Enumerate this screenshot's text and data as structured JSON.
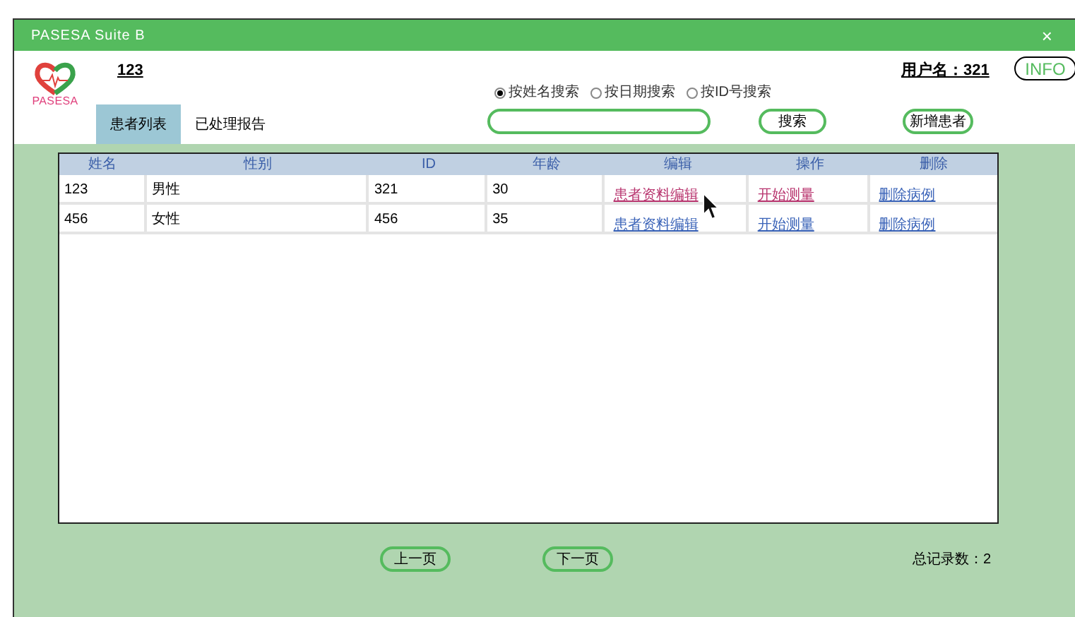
{
  "window": {
    "title": "PASESA Suite B",
    "close": "×"
  },
  "header": {
    "logo_text": "PASESA",
    "patient": "123",
    "user": "用户名：321",
    "info_button": "INFO"
  },
  "tabs": [
    {
      "label": "患者列表",
      "selected": true
    },
    {
      "label": "已处理报告",
      "selected": false
    }
  ],
  "search_modes": [
    {
      "label": "按姓名搜索",
      "selected": true
    },
    {
      "label": "按日期搜索",
      "selected": false
    },
    {
      "label": "按ID号搜索",
      "selected": false
    }
  ],
  "search_button": "搜索",
  "add_button": "新增患者",
  "table": {
    "columns": [
      "姓名",
      "性别",
      "ID",
      "年龄",
      "编辑",
      "操作",
      "删除"
    ],
    "rows": [
      {
        "cells": [
          "123",
          "男性",
          "321",
          "30"
        ],
        "links": [
          {
            "label": "患者资料编辑",
            "color": "#b8346e"
          },
          {
            "label": "开始测量",
            "color": "#b8346e"
          },
          {
            "label": "删除病例",
            "color": "#3a63b8"
          }
        ]
      },
      {
        "cells": [
          "456",
          "女性",
          "456",
          "35"
        ],
        "links": [
          {
            "label": "患者资料编辑",
            "color": "#3a63b8"
          },
          {
            "label": "开始测量",
            "color": "#3a63b8"
          },
          {
            "label": "删除病例",
            "color": "#3a63b8"
          }
        ]
      }
    ]
  },
  "pagination": {
    "prev": "上一页",
    "next": "下一页",
    "total": "总记录数：2"
  }
}
